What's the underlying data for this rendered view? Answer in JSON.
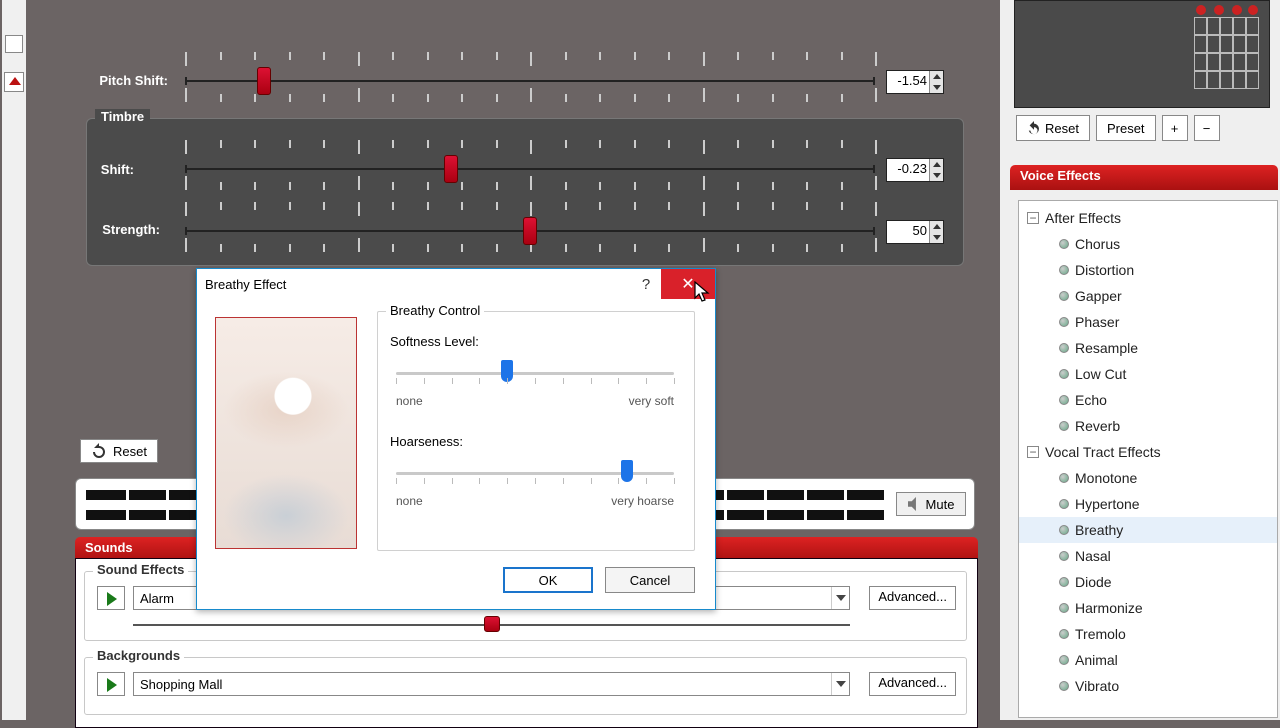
{
  "sliders": {
    "pitchShift": {
      "label": "Pitch Shift:",
      "value": "-1.54",
      "pos": 0.115
    },
    "timbreFrame": "Timbre",
    "timbreShift": {
      "label": "Shift:",
      "value": "-0.23",
      "pos": 0.385
    },
    "timbreStrength": {
      "label": "Strength:",
      "value": "50",
      "pos": 0.5
    }
  },
  "resetBtn": "Reset",
  "muteBtn": "Mute",
  "sounds": {
    "ribbon": "Sounds",
    "soundEffects": {
      "legend": "Sound Effects",
      "value": "Alarm",
      "advanced": "Advanced..."
    },
    "backgrounds": {
      "legend": "Backgrounds",
      "value": "Shopping Mall",
      "advanced": "Advanced..."
    }
  },
  "right": {
    "reset": "Reset",
    "preset": "Preset",
    "voiceEffects": "Voice Effects",
    "tree": {
      "group1": "After Effects",
      "g1": [
        "Chorus",
        "Distortion",
        "Gapper",
        "Phaser",
        "Resample",
        "Low Cut",
        "Echo",
        "Reverb"
      ],
      "group2": "Vocal Tract Effects",
      "g2": [
        "Monotone",
        "Hypertone",
        "Breathy",
        "Nasal",
        "Diode",
        "Harmonize",
        "Tremolo",
        "Animal",
        "Vibrato"
      ],
      "selected": "Breathy"
    }
  },
  "dialog": {
    "title": "Breathy Effect",
    "help": "?",
    "close": "✕",
    "frameTitle": "Breathy Control",
    "softness": {
      "label": "Softness Level:",
      "low": "none",
      "high": "very soft",
      "pos": 0.4
    },
    "hoarse": {
      "label": "Hoarseness:",
      "low": "none",
      "high": "very hoarse",
      "pos": 0.83
    },
    "ok": "OK",
    "cancel": "Cancel"
  }
}
